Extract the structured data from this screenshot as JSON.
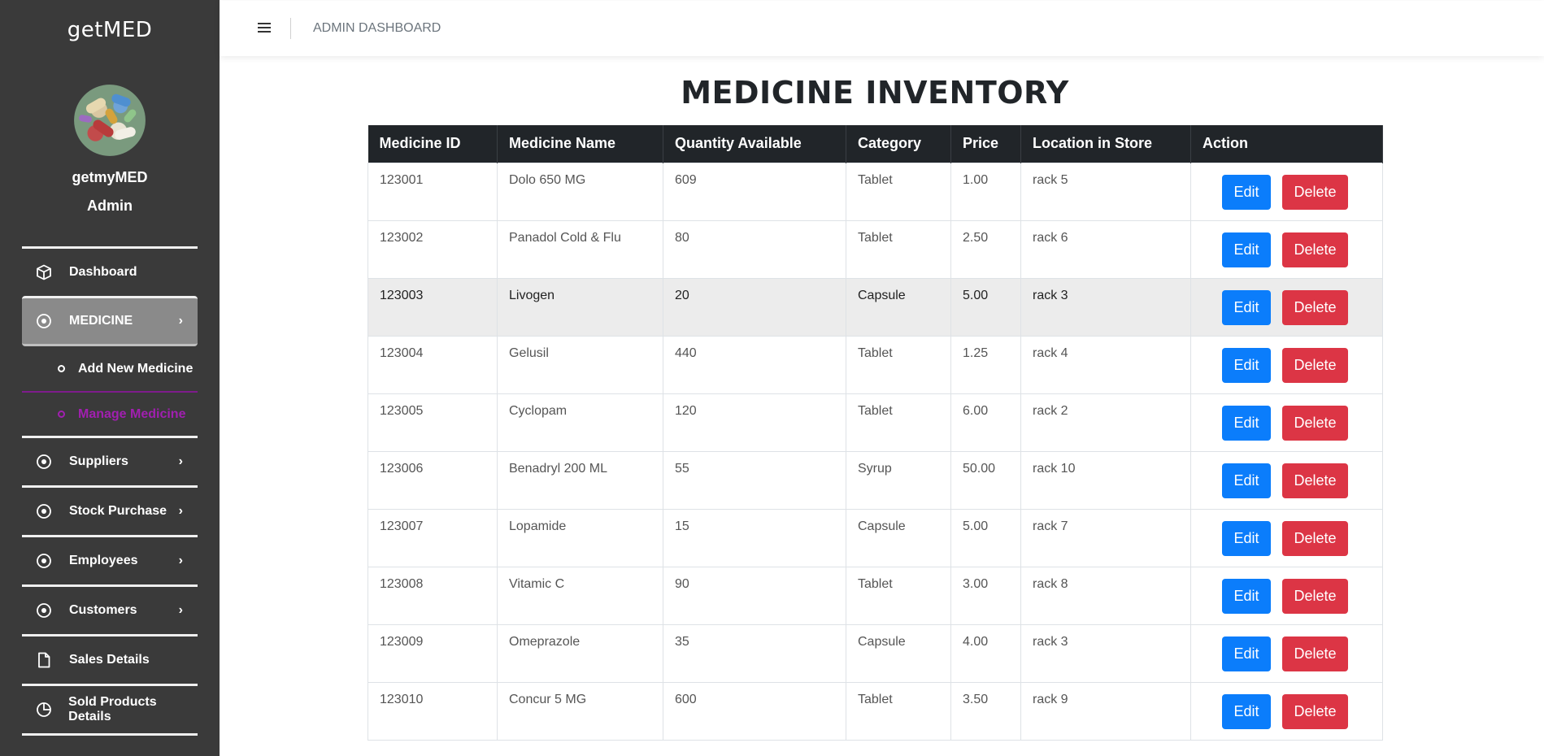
{
  "sidebar": {
    "brand": "getMED",
    "user_name": "getmyMED",
    "user_role": "Admin",
    "items": [
      {
        "label": "Dashboard",
        "icon": "cube-icon"
      },
      {
        "label": "MEDICINE",
        "icon": "circle-target-icon",
        "active": true
      },
      {
        "label": "Suppliers",
        "icon": "circle-target-icon"
      },
      {
        "label": "Stock Purchase",
        "icon": "circle-target-icon"
      },
      {
        "label": "Employees",
        "icon": "circle-target-icon"
      },
      {
        "label": "Customers",
        "icon": "circle-target-icon"
      },
      {
        "label": "Sales Details",
        "icon": "file-icon"
      },
      {
        "label": "Sold Products Details",
        "icon": "pie-chart-icon"
      }
    ],
    "sub_items": [
      {
        "label": "Add New Medicine"
      },
      {
        "label": "Manage Medicine",
        "current": true
      }
    ]
  },
  "topbar": {
    "breadcrumb": "ADMIN DASHBOARD"
  },
  "main": {
    "title": "MEDICINE INVENTORY",
    "columns": [
      "Medicine ID",
      "Medicine Name",
      "Quantity Available",
      "Category",
      "Price",
      "Location in Store",
      "Action"
    ],
    "edit_label": "Edit",
    "delete_label": "Delete",
    "rows": [
      {
        "id": "123001",
        "name": "Dolo 650 MG",
        "qty": "609",
        "category": "Tablet",
        "price": "1.00",
        "location": "rack 5"
      },
      {
        "id": "123002",
        "name": "Panadol Cold & Flu",
        "qty": "80",
        "category": "Tablet",
        "price": "2.50",
        "location": "rack 6"
      },
      {
        "id": "123003",
        "name": "Livogen",
        "qty": "20",
        "category": "Capsule",
        "price": "5.00",
        "location": "rack 3"
      },
      {
        "id": "123004",
        "name": "Gelusil",
        "qty": "440",
        "category": "Tablet",
        "price": "1.25",
        "location": "rack 4"
      },
      {
        "id": "123005",
        "name": "Cyclopam",
        "qty": "120",
        "category": "Tablet",
        "price": "6.00",
        "location": "rack 2"
      },
      {
        "id": "123006",
        "name": "Benadryl 200 ML",
        "qty": "55",
        "category": "Syrup",
        "price": "50.00",
        "location": "rack 10"
      },
      {
        "id": "123007",
        "name": "Lopamide",
        "qty": "15",
        "category": "Capsule",
        "price": "5.00",
        "location": "rack 7"
      },
      {
        "id": "123008",
        "name": "Vitamic C",
        "qty": "90",
        "category": "Tablet",
        "price": "3.00",
        "location": "rack 8"
      },
      {
        "id": "123009",
        "name": "Omeprazole",
        "qty": "35",
        "category": "Capsule",
        "price": "4.00",
        "location": "rack 3"
      },
      {
        "id": "123010",
        "name": "Concur 5 MG",
        "qty": "600",
        "category": "Tablet",
        "price": "3.50",
        "location": "rack 9"
      }
    ],
    "hovered_row": 2
  },
  "colors": {
    "sidebar_bg": "#3a3a3a",
    "active_item_bg": "#8a8a8a",
    "current_sub_item": "#a11fb0",
    "table_header_bg": "#212529",
    "edit_button": "#0b7dfb",
    "delete_button": "#dc3545"
  }
}
